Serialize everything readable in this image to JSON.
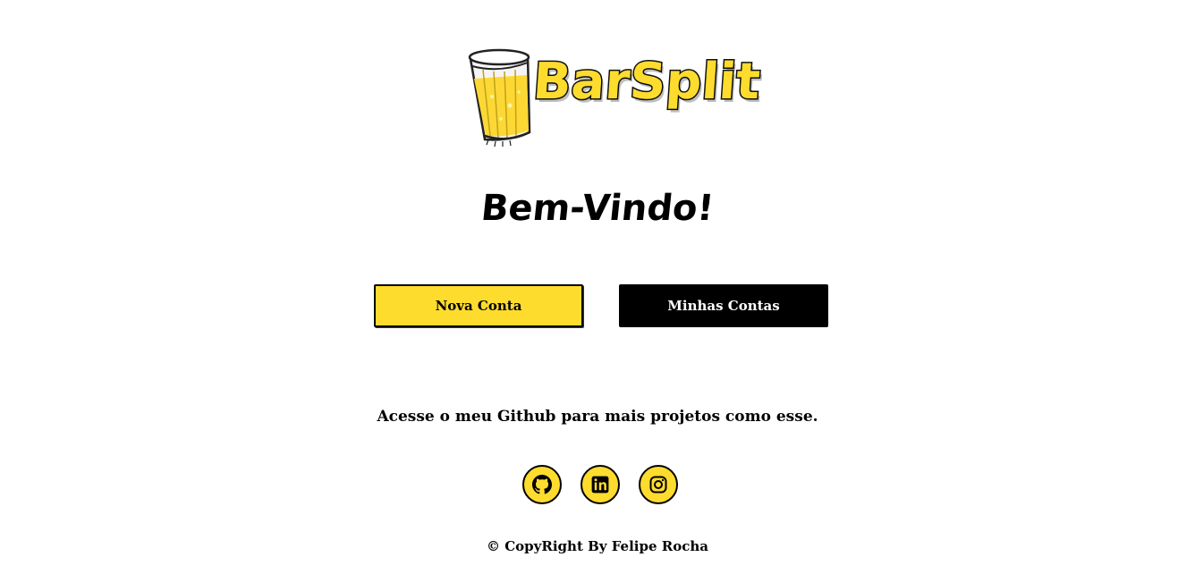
{
  "logo": {
    "brand_text": "BarSplit",
    "icon": "beer-glass-icon"
  },
  "welcome": {
    "title": "Bem-Vindo!"
  },
  "actions": {
    "new_account_label": "Nova Conta",
    "my_accounts_label": "Minhas Contas"
  },
  "github_note": {
    "text": "Acesse o meu Github para mais projetos como esse."
  },
  "social": [
    {
      "name": "github",
      "icon": "github-icon"
    },
    {
      "name": "linkedin",
      "icon": "linkedin-icon"
    },
    {
      "name": "instagram",
      "icon": "instagram-icon"
    }
  ],
  "footer": {
    "copyright": "© CopyRight By Felipe Rocha"
  },
  "colors": {
    "accent": "#fddc2e",
    "dark": "#000000",
    "background": "#ffffff"
  }
}
